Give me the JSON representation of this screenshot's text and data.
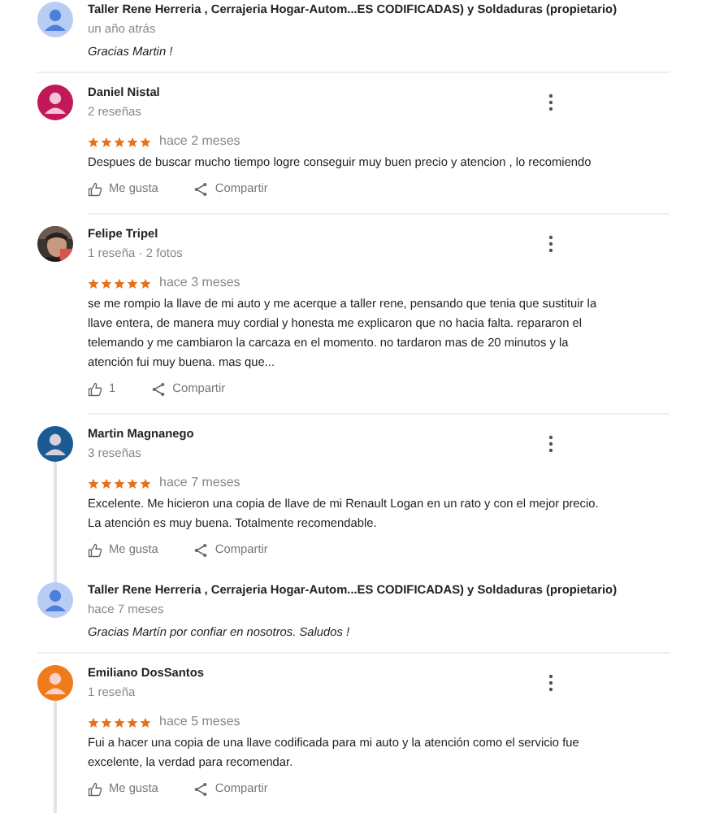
{
  "entries": [
    {
      "kind": "reply",
      "author": "Taller Rene Herreria , Cerrajeria Hogar-Autom...ES CODIFICADAS) y Soldaduras (propietario)",
      "time": "un año atrás",
      "text": "Gracias Martin !"
    },
    {
      "kind": "review",
      "author": "Daniel Nistal",
      "meta": "2 reseñas",
      "photo": false,
      "color": "#c2185b",
      "stars": 5,
      "time": "hace 2 meses",
      "text": "Despues de buscar mucho tiempo logre conseguir muy buen precio y atencion , lo recomiendo",
      "like": "Me gusta",
      "share": "Compartir",
      "thread": false
    },
    {
      "kind": "review",
      "author": "Felipe Tripel",
      "meta": "1 reseña · 2 fotos",
      "photo": true,
      "stars": 5,
      "time": "hace 3 meses",
      "text": "se me rompio la llave de mi auto y me acerque a taller rene, pensando que tenia que sustituir la llave entera, de manera muy cordial y honesta me explicaron que no hacia falta. repararon el telemando y me cambiaron la carcaza en el momento. no tardaron mas de 20 minutos y la atención fui muy buena. mas que...",
      "like": "1",
      "share": "Compartir",
      "thread": false
    },
    {
      "kind": "review",
      "author": "Martin Magnanego",
      "meta": "3 reseñas",
      "photo": false,
      "color": "#1a5b94",
      "stars": 5,
      "time": "hace 7 meses",
      "text": "Excelente. Me hicieron una copia de llave de mi Renault Logan en un rato y con el mejor precio. La atención es muy buena. Totalmente recomendable.",
      "like": "Me gusta",
      "share": "Compartir",
      "thread": true
    },
    {
      "kind": "reply",
      "author": "Taller Rene Herreria , Cerrajeria Hogar-Autom...ES CODIFICADAS) y Soldaduras (propietario)",
      "time": "hace 7 meses",
      "text": "Gracias Martín por confiar en nosotros. Saludos !"
    },
    {
      "kind": "review",
      "author": "Emiliano DosSantos",
      "meta": "1 reseña",
      "photo": false,
      "color": "#ef7b1a",
      "stars": 5,
      "time": "hace 5 meses",
      "text": "Fui a hacer una copia de una llave codificada para mi auto y la atención como el servicio fue excelente, la verdad para recomendar.",
      "like": "Me gusta",
      "share": "Compartir",
      "thread": true
    }
  ]
}
